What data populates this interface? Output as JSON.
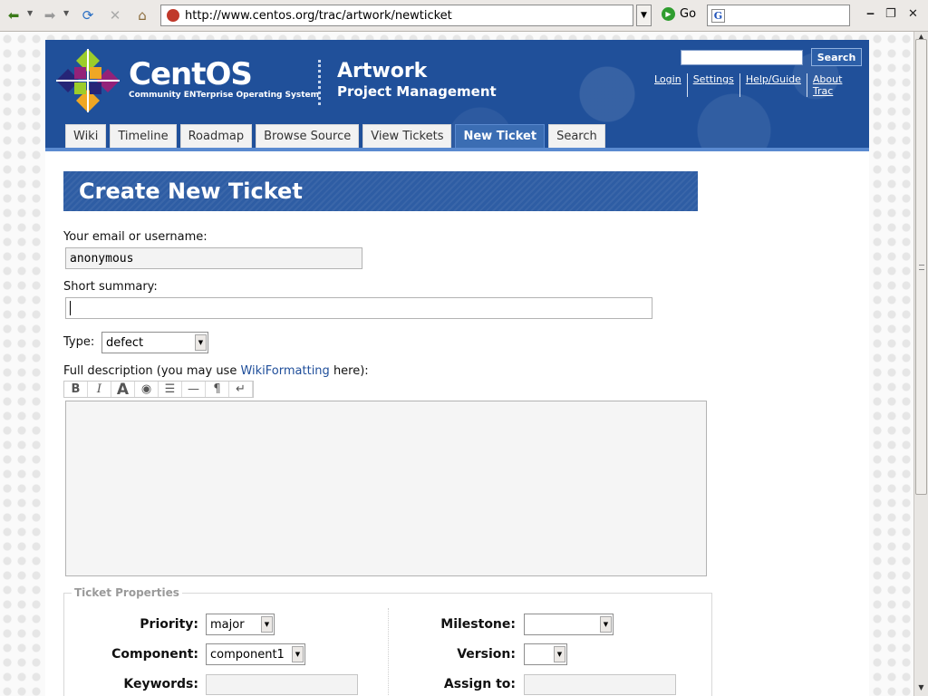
{
  "browser": {
    "url": "http://www.centos.org/trac/artwork/newticket",
    "go_label": "Go",
    "search_engine_icon": "G",
    "back_glyph": "⬅",
    "forward_glyph": "➡",
    "reload_glyph": "⟳",
    "stop_glyph": "✕",
    "home_glyph": "⌂",
    "dropdown_glyph": "▼",
    "go_glyph": "▶",
    "min_glyph": "‒",
    "max_glyph": "❐",
    "close_glyph": "✕",
    "scroll_up_glyph": "▲",
    "scroll_down_glyph": "▼"
  },
  "header": {
    "brand_name": "CentOS",
    "brand_tagline": "Community ENTerprise Operating System",
    "project_title": "Artwork",
    "project_subtitle": "Project Management",
    "search_button": "Search",
    "metanav": [
      "Login",
      "Settings",
      "Help/Guide",
      "About Trac"
    ]
  },
  "tabs": [
    {
      "label": "Wiki"
    },
    {
      "label": "Timeline"
    },
    {
      "label": "Roadmap"
    },
    {
      "label": "Browse Source"
    },
    {
      "label": "View Tickets"
    },
    {
      "label": "New Ticket",
      "active": true
    },
    {
      "label": "Search"
    }
  ],
  "form": {
    "page_title": "Create New Ticket",
    "reporter_label": "Your email or username:",
    "reporter_value": "anonymous",
    "summary_label": "Short summary:",
    "summary_value": "",
    "type_label": "Type:",
    "type_value": "defect",
    "description_prefix": "Full description (you may use ",
    "description_link": "WikiFormatting",
    "description_suffix": " here):",
    "toolbar": [
      "B",
      "I",
      "A",
      "◉",
      "☰",
      "—",
      "¶",
      "↵"
    ]
  },
  "properties": {
    "legend": "Ticket Properties",
    "priority_label": "Priority:",
    "priority_value": "major",
    "component_label": "Component:",
    "component_value": "component1",
    "keywords_label": "Keywords:",
    "milestone_label": "Milestone:",
    "milestone_value": "",
    "version_label": "Version:",
    "version_value": "",
    "assign_label": "Assign to:"
  },
  "colors": {
    "banner_blue": "#20509a",
    "active_tab": "#3b6db3",
    "title_band": "#2e5da4",
    "link": "#1f4e9a"
  }
}
